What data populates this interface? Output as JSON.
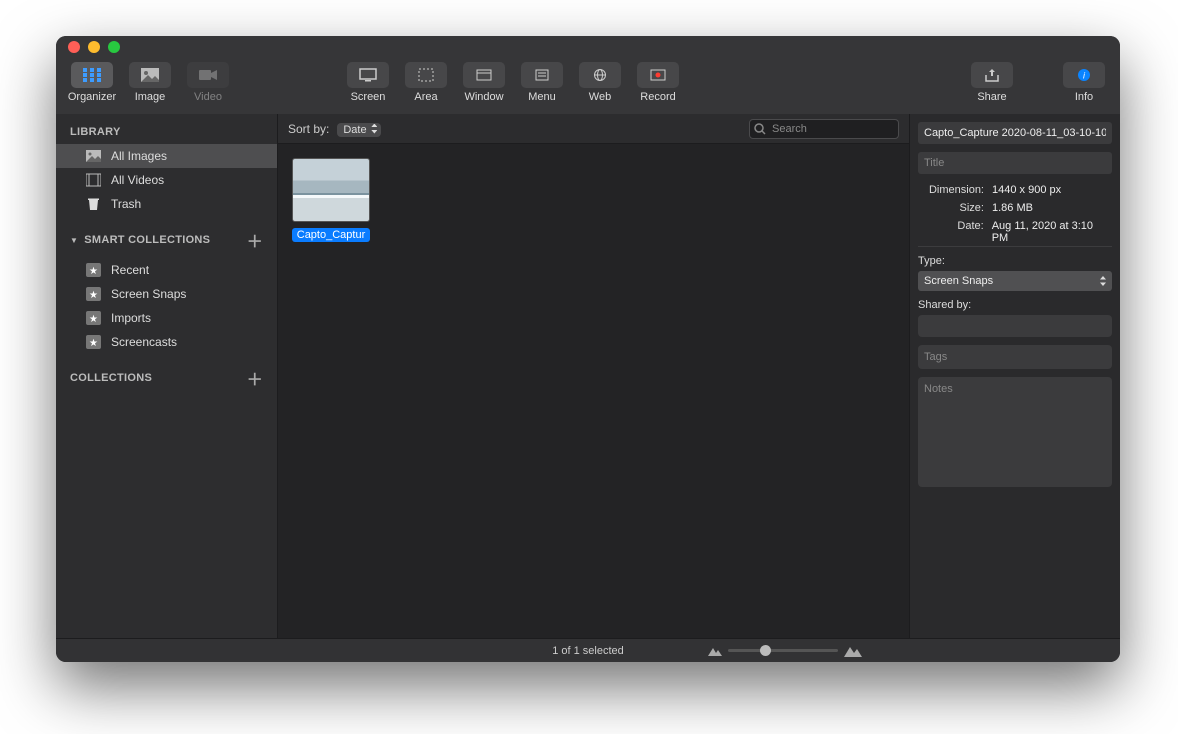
{
  "toolbar": {
    "mode": {
      "organizer": "Organizer",
      "image": "Image",
      "video": "Video"
    },
    "capture": {
      "screen": "Screen",
      "area": "Area",
      "window": "Window",
      "menu": "Menu",
      "web": "Web",
      "record": "Record"
    },
    "share": "Share",
    "info": "Info"
  },
  "sidebar": {
    "library_header": "LIBRARY",
    "library": {
      "all_images": "All Images",
      "all_videos": "All Videos",
      "trash": "Trash"
    },
    "smart_header": "SMART COLLECTIONS",
    "smart": [
      "Recent",
      "Screen Snaps",
      "Imports",
      "Screencasts"
    ],
    "collections_header": "COLLECTIONS"
  },
  "content": {
    "sort_label": "Sort by:",
    "sort_value": "Date",
    "search_placeholder": "Search",
    "thumb_caption": "Capto_Captur"
  },
  "inspector": {
    "filename": "Capto_Capture 2020-08-11_03-10-10",
    "title_placeholder": "Title",
    "dimension_label": "Dimension:",
    "dimension_value": "1440 x 900 px",
    "size_label": "Size:",
    "size_value": "1.86 MB",
    "date_label": "Date:",
    "date_value": "Aug 11, 2020 at 3:10 PM",
    "type_label": "Type:",
    "type_value": "Screen Snaps",
    "shared_label": "Shared by:",
    "tags_placeholder": "Tags",
    "notes_placeholder": "Notes"
  },
  "status": {
    "text": "1 of 1 selected"
  }
}
